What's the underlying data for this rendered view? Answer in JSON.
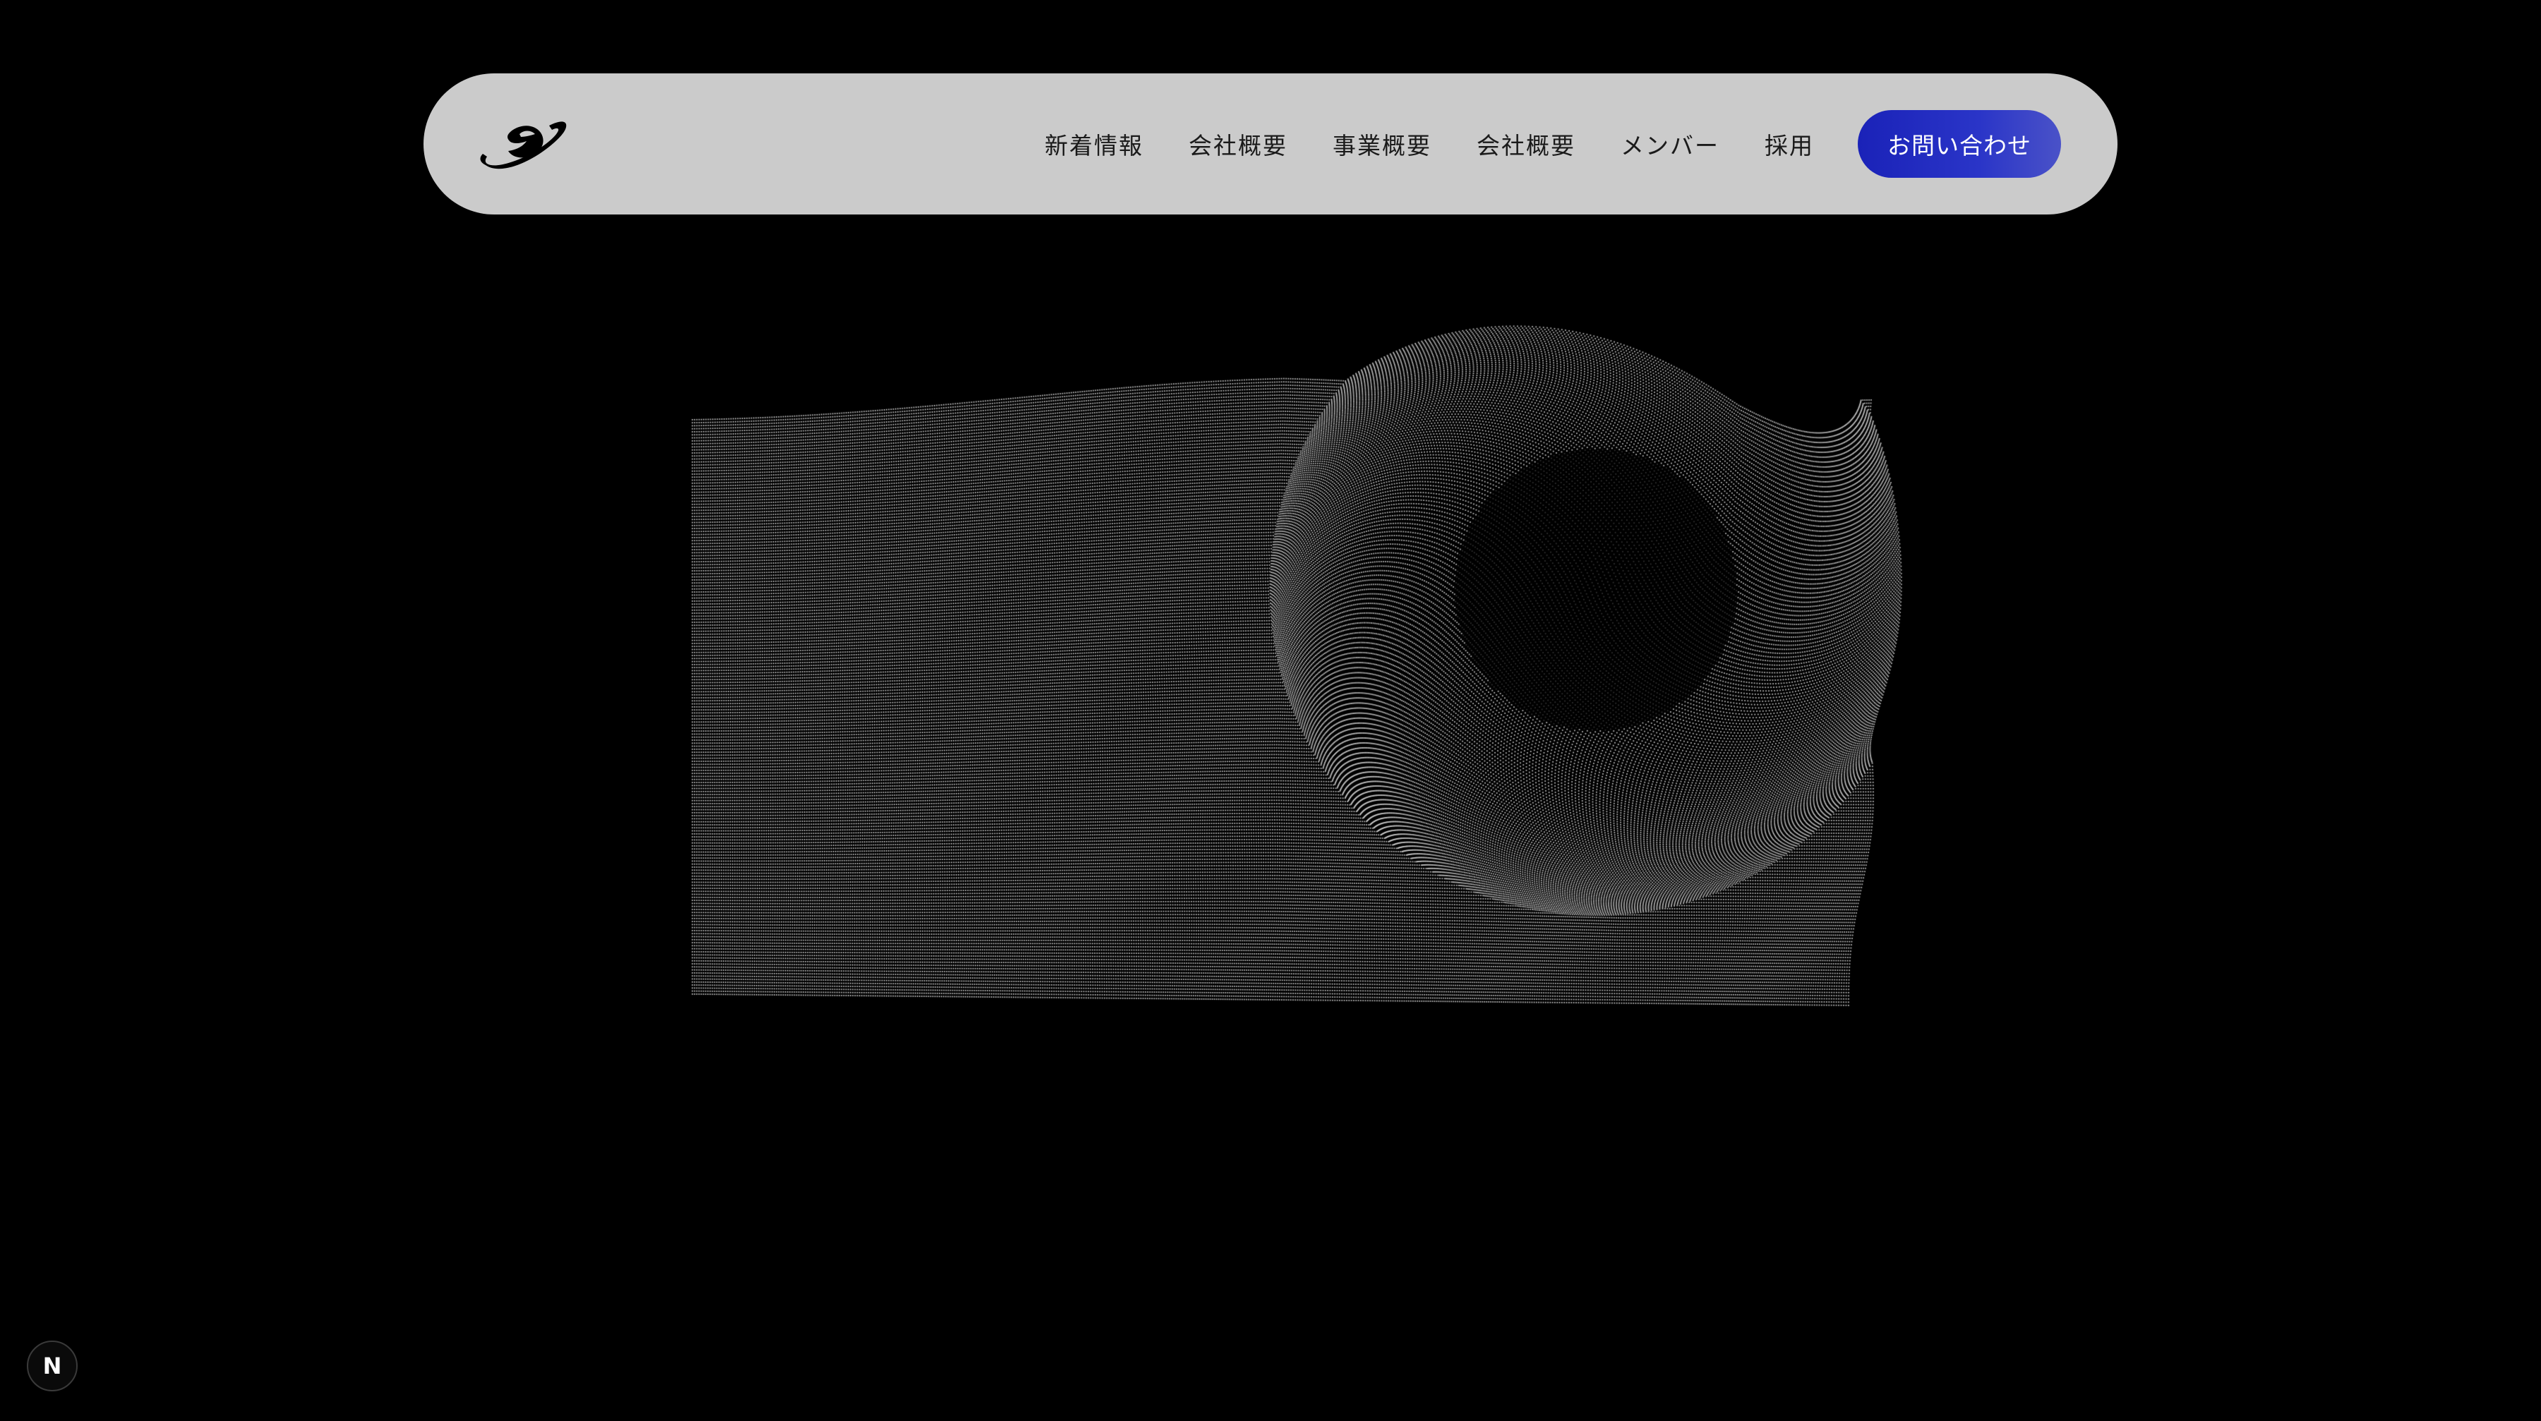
{
  "header": {
    "logo_icon": "planet-logo-icon",
    "nav_items": [
      {
        "label": "新着情報"
      },
      {
        "label": "会社概要"
      },
      {
        "label": "事業概要"
      },
      {
        "label": "会社概要"
      },
      {
        "label": "メンバー"
      },
      {
        "label": "採用"
      }
    ],
    "contact_label": "お問い合わせ"
  },
  "colors": {
    "background": "#000000",
    "nav_background": "#cbcbcb",
    "accent": "#1a22b8",
    "dot": "#d9d9d9"
  },
  "hero": {
    "visual": "dot-grid-wave-surface"
  },
  "dev_badge": {
    "label": "N",
    "icon": "nextjs-icon"
  }
}
